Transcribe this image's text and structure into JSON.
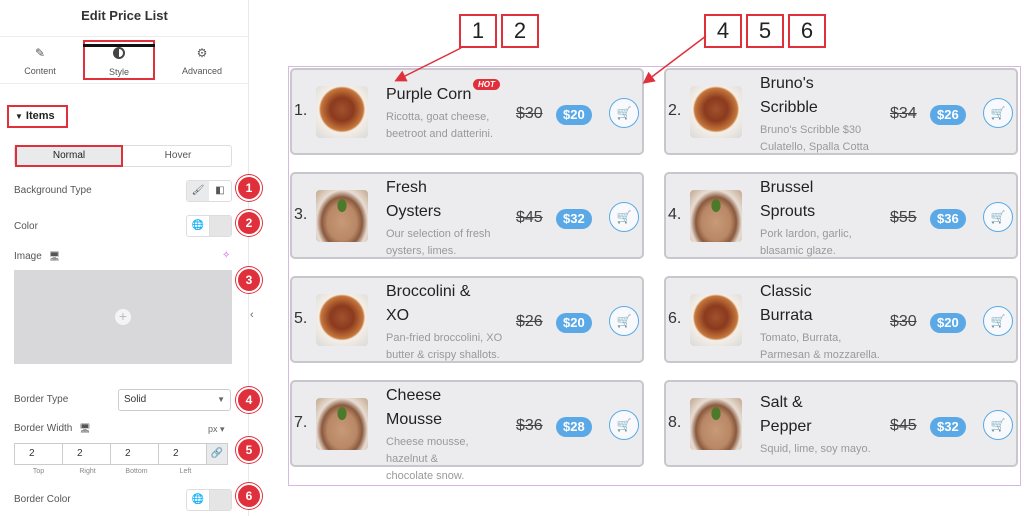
{
  "panel": {
    "title": "Edit Price List",
    "tabs": [
      {
        "label": "Content",
        "icon": "pencil-icon"
      },
      {
        "label": "Style",
        "icon": "contrast-icon"
      },
      {
        "label": "Advanced",
        "icon": "gear-icon"
      }
    ],
    "section": "Items",
    "state_toggle": {
      "normal": "Normal",
      "hover": "Hover"
    },
    "background_type_label": "Background Type",
    "color_label": "Color",
    "image_label": "Image",
    "border_type_label": "Border Type",
    "border_type_value": "Solid",
    "border_width_label": "Border Width",
    "border_width_unit": "px",
    "border_width": {
      "top": "2",
      "right": "2",
      "bottom": "2",
      "left": "2",
      "labels": [
        "Top",
        "Right",
        "Bottom",
        "Left"
      ]
    },
    "border_color_label": "Border Color"
  },
  "badges": [
    "1",
    "2",
    "3",
    "4",
    "5",
    "6"
  ],
  "callouts": [
    "1",
    "2",
    "4",
    "5",
    "6"
  ],
  "items": [
    {
      "num": "1.",
      "title_lines": [
        "Purple Corn"
      ],
      "hot": "HOT",
      "desc_lines": [
        "Ricotta, goat cheese,",
        "beetroot and datterini."
      ],
      "old": "$30",
      "price": "$20",
      "image": "pasta"
    },
    {
      "num": "2.",
      "title_lines": [
        "Bruno's",
        "Scribble"
      ],
      "hot": "",
      "desc_lines": [
        "Bruno's Scribble $30",
        "Culatello, Spalla Cotta"
      ],
      "old": "$34",
      "price": "$26",
      "image": "pasta"
    },
    {
      "num": "3.",
      "title_lines": [
        "Fresh",
        "Oysters"
      ],
      "hot": "",
      "desc_lines": [
        "Our selection of fresh",
        "oysters, limes."
      ],
      "old": "$45",
      "price": "$32",
      "image": "cake"
    },
    {
      "num": "4.",
      "title_lines": [
        "Brussel",
        "Sprouts"
      ],
      "hot": "",
      "desc_lines": [
        "Pork lardon, garlic,",
        "blasamic glaze."
      ],
      "old": "$55",
      "price": "$36",
      "image": "cake"
    },
    {
      "num": "5.",
      "title_lines": [
        "Broccolini &",
        "XO"
      ],
      "hot": "",
      "desc_lines": [
        "Pan-fried broccolini, XO",
        "butter & crispy shallots."
      ],
      "old": "$26",
      "price": "$20",
      "image": "pasta"
    },
    {
      "num": "6.",
      "title_lines": [
        "Classic",
        "Burrata"
      ],
      "hot": "",
      "desc_lines": [
        "Tomato, Burrata,",
        "Parmesan & mozzarella."
      ],
      "old": "$30",
      "price": "$20",
      "image": "pasta"
    },
    {
      "num": "7.",
      "title_lines": [
        "Cheese",
        "Mousse"
      ],
      "hot": "",
      "desc_lines": [
        "Cheese mousse,",
        "hazelnut &",
        "chocolate snow."
      ],
      "old": "$36",
      "price": "$28",
      "image": "cake"
    },
    {
      "num": "8.",
      "title_lines": [
        "Salt &",
        "Pepper"
      ],
      "hot": "",
      "desc_lines": [
        "Squid, lime, soy mayo."
      ],
      "old": "$45",
      "price": "$32",
      "image": "cake"
    }
  ],
  "colors": {
    "accent": "#e0303c",
    "price_pill": "#5aa9e6",
    "card_bg": "#ececee"
  }
}
